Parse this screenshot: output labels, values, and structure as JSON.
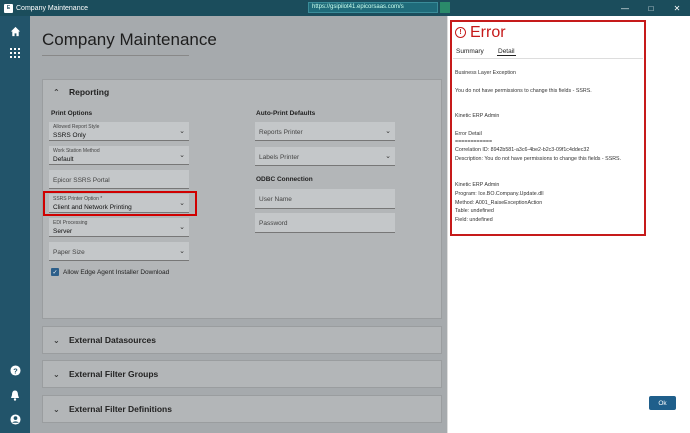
{
  "window": {
    "title": "Company Maintenance",
    "url": "https://gsipilot41.epicorsaas.com/s",
    "controls": {
      "minimize": "—",
      "maximize": "□",
      "close": "✕"
    }
  },
  "nav": {
    "icons": [
      "home-icon",
      "apps-grid-icon",
      "help-icon",
      "notifications-icon",
      "user-icon"
    ]
  },
  "page": {
    "title": "Company Maintenance"
  },
  "reporting": {
    "header": "Reporting",
    "print_options_label": "Print Options",
    "auto_print_label": "Auto-Print Defaults",
    "odbc_label": "ODBC Connection",
    "allowed_report_style": {
      "label": "Allowed Report Style",
      "value": "SSRS Only"
    },
    "work_station_method": {
      "label": "Work Station Method",
      "value": "Default"
    },
    "epicor_ssrs_portal": {
      "placeholder": "Epicor SSRS Portal"
    },
    "ssrs_printer_option": {
      "label": "SSRS Printer Option *",
      "value": "Client and Network Printing"
    },
    "edi_processing": {
      "label": "EDI Processing",
      "value": "Server"
    },
    "paper_size": {
      "placeholder": "Paper Size"
    },
    "allow_edge_agent": {
      "label": "Allow Edge Agent Installer Download",
      "checked": true
    },
    "reports_printer": {
      "placeholder": "Reports Printer"
    },
    "labels_printer": {
      "placeholder": "Labels Printer"
    },
    "user_name": {
      "placeholder": "User Name"
    },
    "password": {
      "placeholder": "Password"
    }
  },
  "sections": [
    {
      "label": "External Datasources"
    },
    {
      "label": "External Filter Groups"
    },
    {
      "label": "External Filter Definitions"
    }
  ],
  "error": {
    "title": "Error",
    "tabs": [
      "Summary",
      "Detail"
    ],
    "active_tab": "Detail",
    "lines": [
      "Business Layer Exception",
      "You do not have permissions to change this fields - SSRS.",
      "Kinetic ERP Admin",
      "Error Detail",
      "============",
      "Correlation ID: 8942b581-a3c6-4be2-b2c3-09f1c4ddec32",
      "Description: You do not have permissions to change this fields - SSRS.",
      "Kinetic ERP Admin",
      "Program: Ice.BO.Company.Update.dll",
      "Method: A001_RaiseExceptionAction",
      "Table: undefined",
      "Field: undefined"
    ],
    "ok_label": "Ok"
  },
  "colors": {
    "nav": "#22546a",
    "titlebar": "#1b4d5c",
    "error_red": "#c61a1a",
    "ok_button": "#1f5f8b"
  }
}
